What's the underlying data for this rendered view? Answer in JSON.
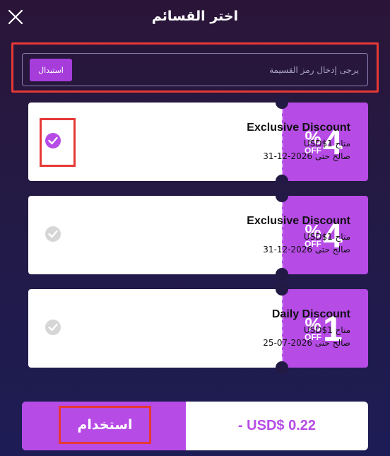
{
  "header": {
    "title": "اختر القسائم",
    "close_icon": "close-icon"
  },
  "code_entry": {
    "placeholder": "يرجى إدخال رمز القسيمة",
    "redeem_label": "استبدال"
  },
  "coupons": [
    {
      "name": "Exclusive Discount",
      "amount": "USD$1 متاح",
      "expiry": "صالح حتى 2026-12-31",
      "off_pct": "%",
      "off_word": "OFF",
      "off_num": "4",
      "selected": true
    },
    {
      "name": "Exclusive Discount",
      "amount": "USD$1 متاح",
      "expiry": "صالح حتى 2026-12-31",
      "off_pct": "%",
      "off_word": "OFF",
      "off_num": "4",
      "selected": false
    },
    {
      "name": "Daily Discount",
      "amount": "USD$1 متاح",
      "expiry": "صالح حتى 2026-07-25",
      "off_pct": "%",
      "off_word": "OFF",
      "off_num": "1",
      "selected": false
    }
  ],
  "footer": {
    "use_label": "استخدام",
    "total": "- USD$ 0.22"
  },
  "colors": {
    "accent": "#b64be6",
    "highlight": "#e53935"
  }
}
